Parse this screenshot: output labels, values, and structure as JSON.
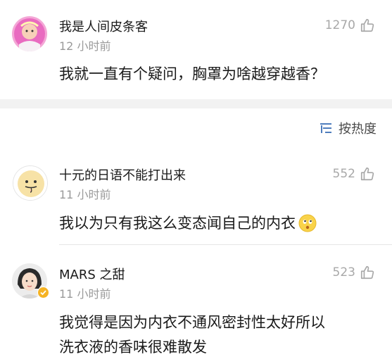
{
  "comments": [
    {
      "username": "我是人间皮条客",
      "time": "12 小时前",
      "likes": "1270",
      "lines": [
        "我就一直有个疑问，胸罩为啥越穿越香？"
      ]
    },
    {
      "username": "十元的日语不能打出来",
      "time": "11 小时前",
      "likes": "552",
      "lines": [
        "我以为只有我这么变态闻自己的内衣"
      ]
    },
    {
      "username": "MARS 之甜",
      "time": "11 小时前",
      "likes": "523",
      "lines": [
        "我觉得是因为内衣不通风密封性太好所以",
        "洗衣液的香味很难散发"
      ]
    }
  ],
  "sort": {
    "label": "按热度"
  },
  "colors": {
    "muted": "#9a9a9a",
    "divider": "#f2f2f2",
    "badge": "#f5b324"
  },
  "icons": [
    "like-thumb-icon",
    "sort-icon",
    "thinking-emoji-icon",
    "verified-badge-icon"
  ]
}
